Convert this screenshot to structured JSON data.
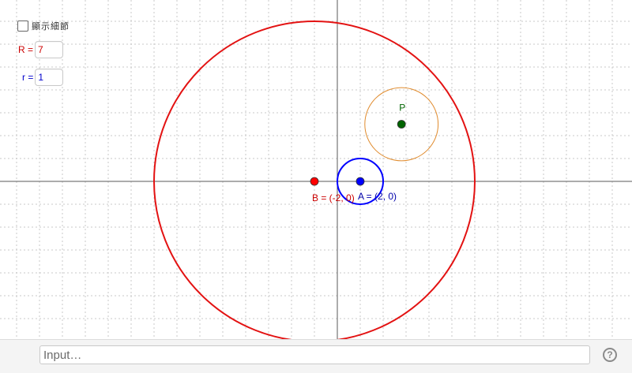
{
  "controls": {
    "show_details_label": "顯示細節",
    "R": {
      "label": "R =",
      "value": "7",
      "color": "#cc0000"
    },
    "r": {
      "label": "r =",
      "value": "1",
      "color": "#0000cc"
    }
  },
  "graphics": {
    "points": {
      "B": {
        "label": "B = (-2, 0)",
        "x": -2,
        "y": 0,
        "color": "#ff0000"
      },
      "A": {
        "label": "A = (2, 0)",
        "x": 2,
        "y": 0,
        "color": "#0000ff"
      },
      "P": {
        "label": "P",
        "x": 5.6,
        "y": 5,
        "color": "#006400"
      }
    },
    "circles": {
      "big": {
        "center": "B",
        "radius": 14,
        "color": "#e31212"
      },
      "small": {
        "center": "A",
        "radius": 2,
        "color": "#0000ff"
      },
      "orange": {
        "center": "P",
        "radius": 3.2,
        "color": "#e08b2d"
      }
    },
    "colors": {
      "grid": "#c8c8c8",
      "axis": "#5a5a5a",
      "label_B": "#cc0000",
      "label_A": "#0000aa",
      "label_P": "#006400"
    }
  },
  "input_bar": {
    "placeholder": "Input…",
    "help_icon": "?"
  }
}
